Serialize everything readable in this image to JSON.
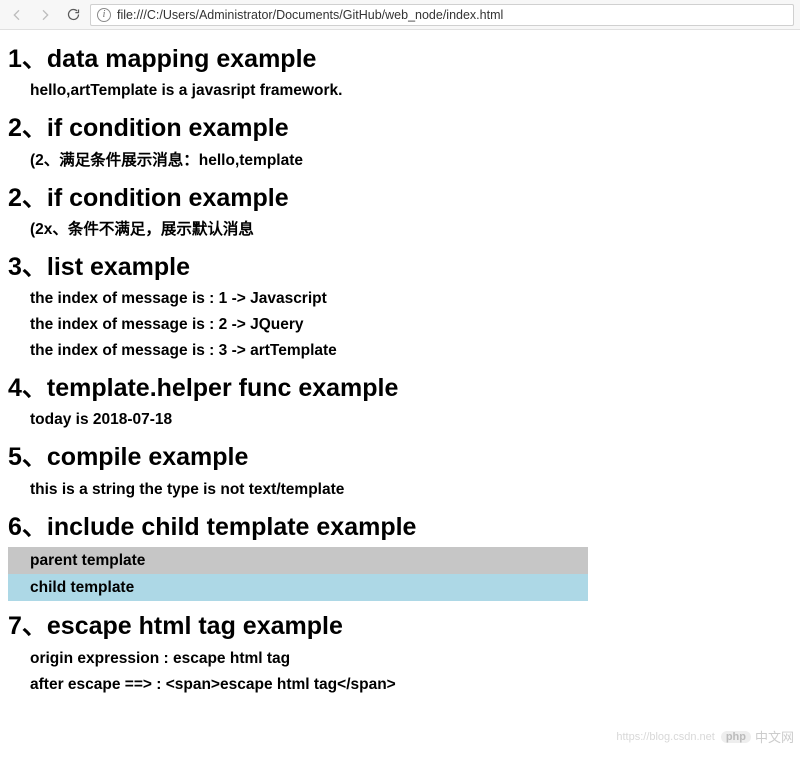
{
  "toolbar": {
    "url": "file:///C:/Users/Administrator/Documents/GitHub/web_node/index.html"
  },
  "sections": {
    "s1": {
      "title": "1、data mapping example",
      "line1": "hello,artTemplate is a javasript framework."
    },
    "s2a": {
      "title": "2、if condition example",
      "line1": "(2、满足条件展示消息：hello,template"
    },
    "s2b": {
      "title": "2、if condition example",
      "line1": "(2x、条件不满足，展示默认消息"
    },
    "s3": {
      "title": "3、list example",
      "lines": [
        "the index of message is : 1 -> Javascript",
        "the index of message is : 2 -> JQuery",
        "the index of message is : 3 -> artTemplate"
      ]
    },
    "s4": {
      "title": "4、template.helper func example",
      "line1": "today is 2018-07-18"
    },
    "s5": {
      "title": "5、compile example",
      "line1": "this is a string the type is not text/template"
    },
    "s6": {
      "title": "6、include child template example",
      "parent": "parent template",
      "child": "child template"
    },
    "s7": {
      "title": "7、escape html tag example",
      "line1": "origin expression : escape html tag",
      "line2": "after escape ==> : <span>escape html tag</span>"
    }
  },
  "watermark": {
    "link": "https://blog.csdn.net",
    "badge": "php",
    "text": "中文网"
  }
}
